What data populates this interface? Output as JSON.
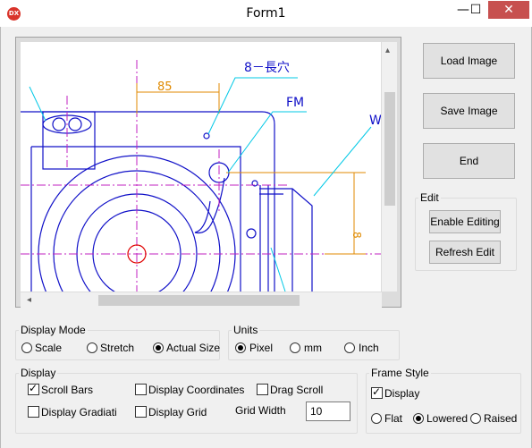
{
  "window": {
    "title": "Form1",
    "app_icon_label": "DX",
    "minimize_glyph": "—",
    "maximize_glyph": "☐",
    "close_glyph": "✕"
  },
  "viewer": {
    "drawing_labels": {
      "dim_85": "85",
      "note_holes": "8－長穴",
      "note_fm": "FM",
      "note_w": "W",
      "dim_side": "8"
    },
    "scroll_up": "▴",
    "scroll_left": "◂"
  },
  "buttons": {
    "load": "Load Image",
    "save": "Save Image",
    "end": "End"
  },
  "edit": {
    "legend": "Edit",
    "enable": "Enable Editing",
    "refresh": "Refresh Edit"
  },
  "display_mode": {
    "legend": "Display Mode",
    "options": [
      "Scale",
      "Stretch",
      "Actual Size"
    ],
    "selected": "Actual Size"
  },
  "units": {
    "legend": "Units",
    "options": [
      "Pixel",
      "mm",
      "Inch"
    ],
    "selected": "Pixel"
  },
  "display": {
    "legend": "Display",
    "scroll_bars": "Scroll Bars",
    "display_coordinates": "Display Coordinates",
    "drag_scroll": "Drag Scroll",
    "display_gradiati": "Display Gradiati",
    "display_grid": "Display Grid",
    "grid_width_label": "Grid Width",
    "grid_width_value": "10"
  },
  "frame_style": {
    "legend": "Frame Style",
    "display": "Display",
    "options": [
      "Flat",
      "Lowered",
      "Raised"
    ],
    "selected": "Lowered"
  },
  "colors": {
    "drawing_blue": "#1010c8",
    "drawing_magenta": "#c020c0",
    "drawing_orange": "#e08a00",
    "drawing_cyan": "#00c8e6",
    "drawing_red": "#e00000",
    "close_red": "#c7504f"
  }
}
